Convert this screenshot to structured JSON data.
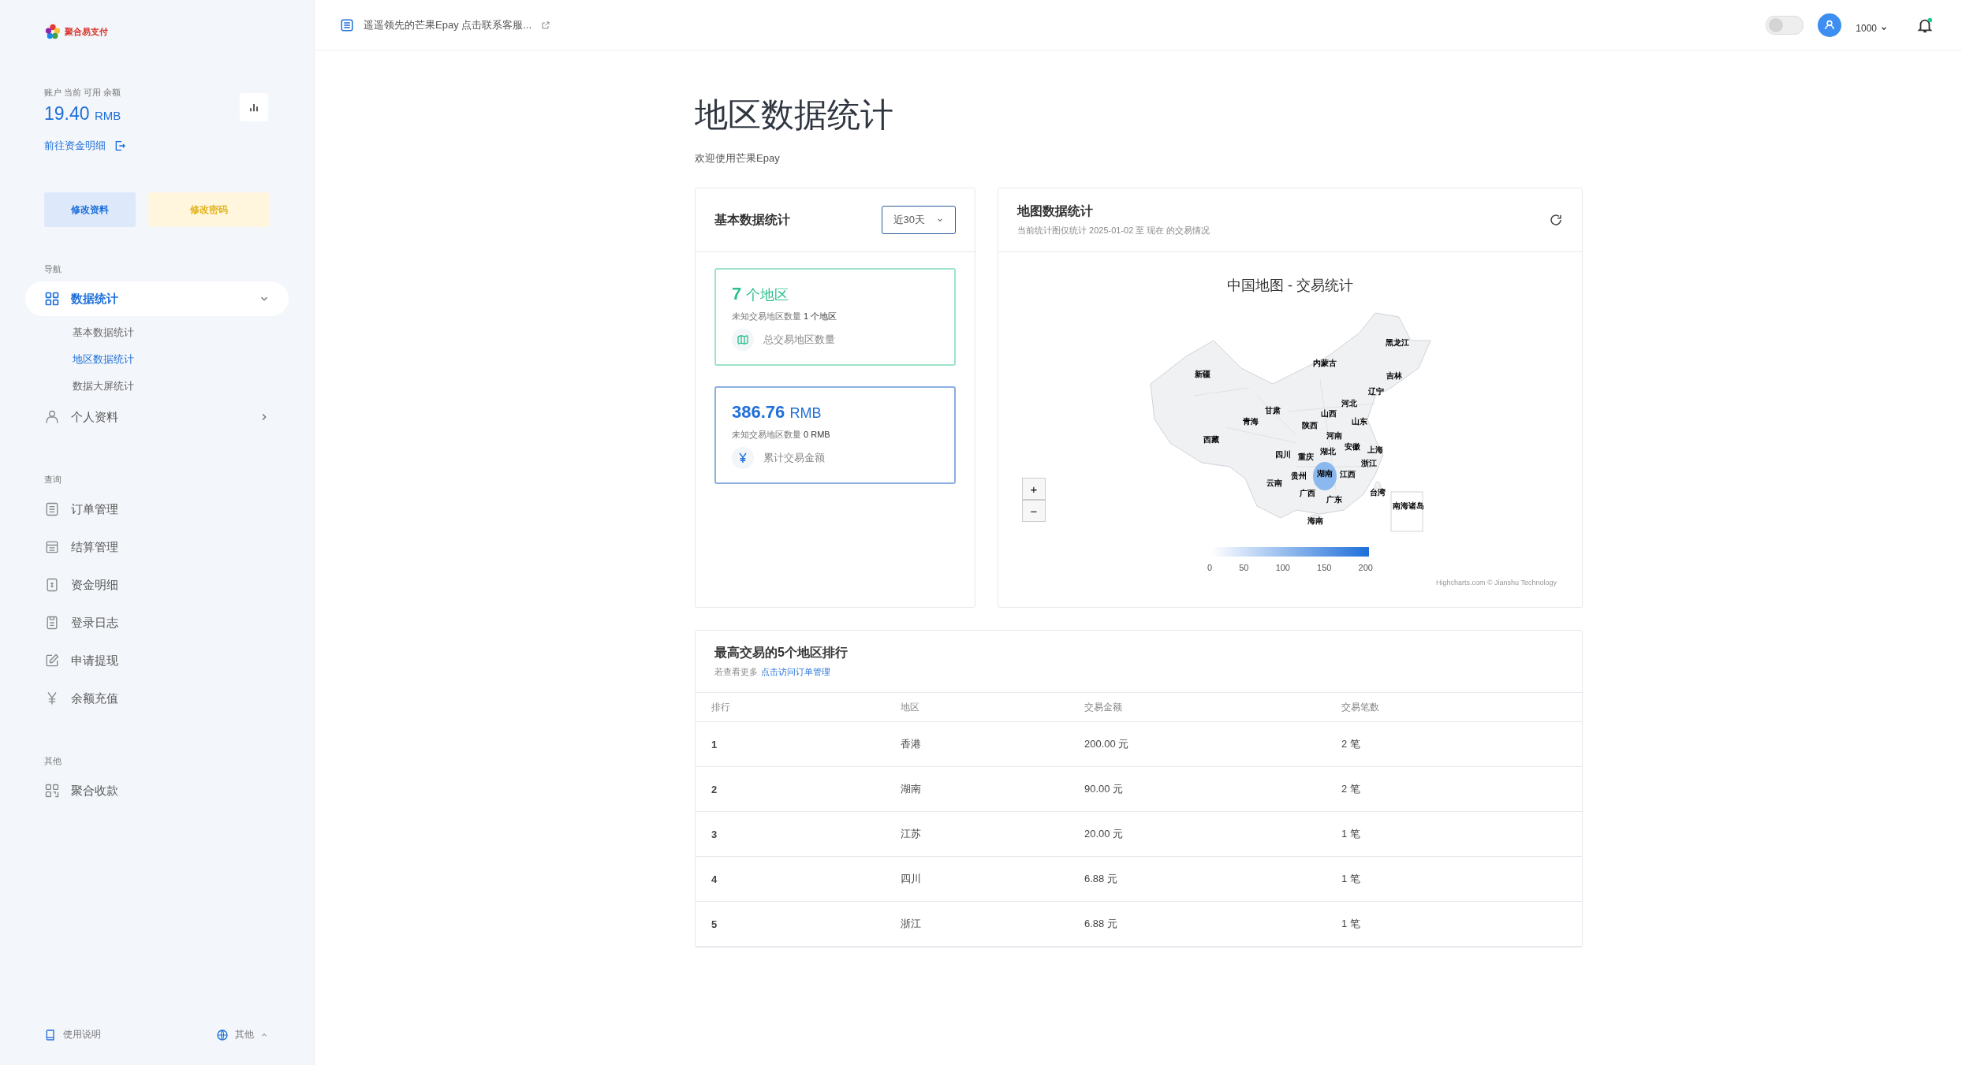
{
  "logo": {
    "text": "聚合易支付"
  },
  "balance": {
    "label": "账户 当前 可用 余额",
    "amount": "19.40",
    "unit": "RMB",
    "link": "前往资金明细"
  },
  "profile_buttons": [
    {
      "label": "修改资料",
      "kind": "primary"
    },
    {
      "label": "修改密码",
      "kind": "warning"
    }
  ],
  "sidebar": {
    "sections": [
      {
        "heading": "导航",
        "items": [
          {
            "label": "数据统计",
            "kind": "grid",
            "expanded": true,
            "selected": true,
            "children": [
              {
                "label": "基本数据统计",
                "selected": false
              },
              {
                "label": "地区数据统计",
                "selected": true
              },
              {
                "label": "数据大屏统计",
                "selected": false
              }
            ]
          },
          {
            "label": "个人资料",
            "kind": "user",
            "expanded": false,
            "selected": false
          }
        ]
      },
      {
        "heading": "查询",
        "items": [
          {
            "label": "订单管理",
            "kind": "list",
            "selected": false
          },
          {
            "label": "结算管理",
            "kind": "lines",
            "selected": false
          },
          {
            "label": "资金明细",
            "kind": "bill",
            "selected": false
          },
          {
            "label": "登录日志",
            "kind": "log",
            "selected": false
          },
          {
            "label": "申请提现",
            "kind": "edit",
            "selected": false
          },
          {
            "label": "余额充值",
            "kind": "yen",
            "selected": false
          }
        ]
      },
      {
        "heading": "其他",
        "items": [
          {
            "label": "聚合收款",
            "kind": "qr",
            "selected": false
          }
        ]
      }
    ],
    "footer": {
      "help": "使用说明",
      "language": "其他"
    }
  },
  "header": {
    "notice": "遥遥领先的芒果Epay 点击联系客服...",
    "theme_toggle": {
      "on": false
    },
    "user": "1000",
    "notification_dot": true
  },
  "page": {
    "title": "地区数据统计",
    "subtitle": "欢迎使用芒果Epay"
  },
  "basic_stats": {
    "title": "基本数据统计",
    "range": "近30天",
    "cards": [
      {
        "kind": "regions",
        "value": "7",
        "unit": "个地区",
        "note": "未知交易地区数量",
        "note_value": "1 个地区",
        "caption": "总交易地区数量"
      },
      {
        "kind": "amount",
        "value": "386.76",
        "unit": "RMB",
        "note": "未知交易地区数量",
        "note_value": "0 RMB",
        "caption": "累计交易金额"
      }
    ]
  },
  "map_stats": {
    "title": "地图数据统计",
    "subtitle": "当前统计图仅统计 2025-01-02 至 现在 的交易情况",
    "chart_title": "中国地图 - 交易统计",
    "zoom_in": "+",
    "zoom_out": "−",
    "credits": "Highcharts.com © Jianshu Technology",
    "legend_ticks": [
      "0",
      "50",
      "100",
      "150",
      "200"
    ],
    "regions": [
      {
        "name": "黑龙江",
        "shaded": false
      },
      {
        "name": "内蒙古",
        "shaded": false
      },
      {
        "name": "新疆",
        "shaded": false
      },
      {
        "name": "吉林",
        "shaded": false
      },
      {
        "name": "辽宁",
        "shaded": false
      },
      {
        "name": "河北",
        "shaded": false
      },
      {
        "name": "甘肃",
        "shaded": false
      },
      {
        "name": "山西",
        "shaded": false
      },
      {
        "name": "青海",
        "shaded": false
      },
      {
        "name": "山东",
        "shaded": false
      },
      {
        "name": "陕西",
        "shaded": false
      },
      {
        "name": "河南",
        "shaded": false
      },
      {
        "name": "西藏",
        "shaded": false
      },
      {
        "name": "安徽",
        "shaded": false
      },
      {
        "name": "上海",
        "shaded": false
      },
      {
        "name": "四川",
        "shaded": false
      },
      {
        "name": "重庆",
        "shaded": false
      },
      {
        "name": "湖北",
        "shaded": false
      },
      {
        "name": "浙江",
        "shaded": false
      },
      {
        "name": "贵州",
        "shaded": false
      },
      {
        "name": "湖南",
        "shaded": true
      },
      {
        "name": "江西",
        "shaded": false
      },
      {
        "name": "云南",
        "shaded": false
      },
      {
        "name": "广西",
        "shaded": false
      },
      {
        "name": "台湾",
        "shaded": false
      },
      {
        "name": "广东",
        "shaded": false
      },
      {
        "name": "南海诸岛",
        "shaded": false
      },
      {
        "name": "海南",
        "shaded": false
      }
    ]
  },
  "ranking": {
    "title": "最高交易的5个地区排行",
    "hint": "若查看更多",
    "hint_link": "点击访问订单管理",
    "columns": [
      "排行",
      "地区",
      "交易金额",
      "交易笔数"
    ],
    "rows": [
      [
        "1",
        "香港",
        "200.00 元",
        "2 笔"
      ],
      [
        "2",
        "湖南",
        "90.00 元",
        "2 笔"
      ],
      [
        "3",
        "江苏",
        "20.00 元",
        "1 笔"
      ],
      [
        "4",
        "四川",
        "6.88 元",
        "1 笔"
      ],
      [
        "5",
        "浙江",
        "6.88 元",
        "1 笔"
      ]
    ]
  }
}
